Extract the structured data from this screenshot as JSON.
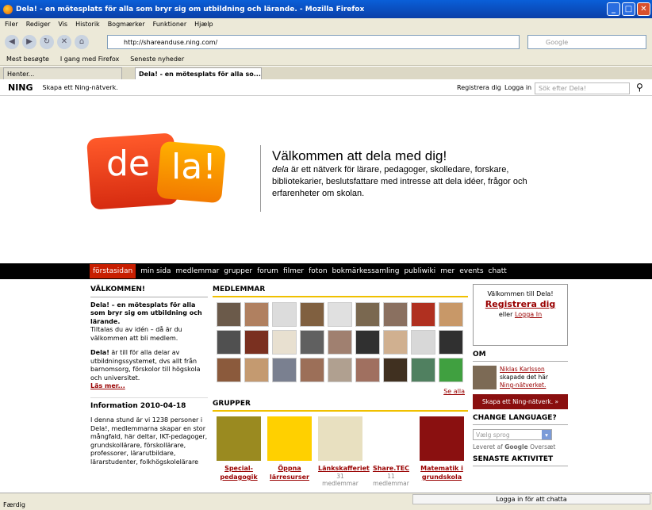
{
  "window": {
    "title": "Dela! - en mötesplats för alla som bryr sig om utbildning och lärande. - Mozilla Firefox"
  },
  "menu": [
    "Filer",
    "Rediger",
    "Vis",
    "Historik",
    "Bogmærker",
    "Funktioner",
    "Hjælp"
  ],
  "url": "http://shareanduse.ning.com/",
  "browser_search_placeholder": "Google",
  "bookmarks": [
    "Mest besøgte",
    "I gang med Firefox",
    "Seneste nyheder"
  ],
  "tabs": [
    {
      "label": "Henter..."
    },
    {
      "label": "Dela! - en mötesplats för alla so..."
    }
  ],
  "ning": {
    "logo": "NING",
    "create": "Skapa ett Ning-nätverk.",
    "register": "Registrera dig",
    "login": "Logga in",
    "search_placeholder": "Sök efter Dela!"
  },
  "hero": {
    "logo_part1": "de",
    "logo_part2": "la!",
    "heading": "Välkommen att dela med dig!",
    "body_em": "dela",
    "body": "är ett nätverk för lärare, pedagoger, skolledare, forskare, bibliotekarier, beslutsfattare med intresse att dela idéer, frågor och erfarenheter om skolan."
  },
  "nav": [
    "förstasidan",
    "min sida",
    "medlemmar",
    "grupper",
    "forum",
    "filmer",
    "foton",
    "bokmärkessamling",
    "publiwiki",
    "mer",
    "events",
    "chatt"
  ],
  "welcome": {
    "heading": "VÄLKOMMEN!",
    "bold_intro": "Dela! – en mötesplats för alla som bryr sig om utbildning och lärande.",
    "intro": "Tiltalas du av idén – då är du välkommen att bli medlem.",
    "para2_bold": "Dela!",
    "para2": "är till för alla delar av utbildningssystemet, dvs allt från barnomsorg, förskolor till högskola och universitet.",
    "read_more": "Läs mer...",
    "info_heading": "Information 2010-04-18",
    "info_text": "I denna stund är vi 1238 personer i Dela!, medlemmarna skapar en stor mångfald, här deltar, IKT-pedagoger, grundskollärare, förskollärare, professorer, lärarutbildare, lärarstudenter, folkhögskolelärare"
  },
  "members": {
    "heading": "MEDLEMMAR",
    "see_all": "Se alla",
    "colors": [
      "#6b5a4a",
      "#b08060",
      "#dcdcdc",
      "#806040",
      "#e0e0e0",
      "#7a6850",
      "#8a7060",
      "#b03020",
      "#c89868",
      "#505050",
      "#7a3020",
      "#e8e0d0",
      "#606060",
      "#a08070",
      "#303030",
      "#d0b090",
      "#d8d8d8",
      "#303030",
      "#8b5a3c",
      "#c49a70",
      "#7a8090",
      "#9c6f58",
      "#b0a090",
      "#a07060",
      "#403020",
      "#508060",
      "#40a040"
    ]
  },
  "groups": {
    "heading": "GRUPPER",
    "items": [
      {
        "name": "Special-pedagogik",
        "count": "",
        "color": "#9a8a20"
      },
      {
        "name": "Öppna lärresurser",
        "count": "",
        "color": "#ffd000"
      },
      {
        "name": "Länkskafferiet",
        "count": "31 medlemmar",
        "color": "#e8e0c0"
      },
      {
        "name": "Share.TEC",
        "count": "11 medlemmar",
        "color": "#ffffff"
      },
      {
        "name": "Matematik i grundskola",
        "count": "",
        "color": "#8a1010"
      }
    ]
  },
  "side": {
    "welcome_line": "Välkommen till Dela!",
    "register": "Registrera dig",
    "or": "eller",
    "login": "Logga In",
    "om_heading": "OM",
    "om_name": "Niklas Karlsson",
    "om_text": "skapade det här",
    "om_link": "Ning-nätverket.",
    "create_btn": "Skapa ett Ning-nätverk. »",
    "lang_heading": "CHANGE LANGUAGE?",
    "lang_select": "Vælg sprog",
    "delivered": "Leveret af",
    "google": "Google",
    "translate": "Oversæt",
    "activity_heading": "SENASTE AKTIVITET"
  },
  "status": {
    "text": "Færdig",
    "chat": "Logga in för att chatta"
  }
}
